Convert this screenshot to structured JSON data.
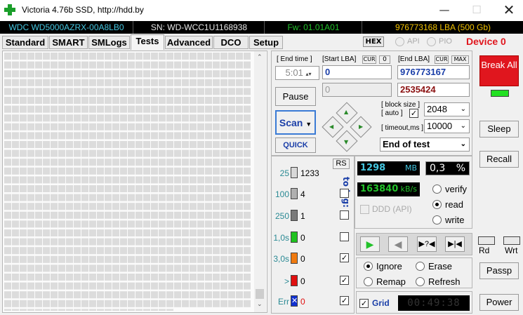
{
  "window": {
    "title": "Victoria 4.76b SSD, http://hdd.by"
  },
  "info": {
    "model": "WDC WD5000AZRX-00A8LB0",
    "serial": "SN: WD-WCC1U1168938",
    "firmware": "Fw: 01.01A01",
    "lba": "976773168 LBA (500 Gb)"
  },
  "tabs": [
    "Standard",
    "SMART",
    "SMLogs",
    "Tests",
    "Advanced",
    "DCO",
    "Setup"
  ],
  "active_tab": "Tests",
  "modes": {
    "hex": "HEX",
    "api": "API",
    "pio": "PIO"
  },
  "device": "Device 0",
  "endtime": {
    "label": "[ End time ]",
    "value": "5:01"
  },
  "startlba": {
    "label": "[Start LBA]",
    "cur": "CUR",
    "zero": "0",
    "value": "0",
    "current": "0"
  },
  "endlba": {
    "label": "[End LBA]",
    "cur": "CUR",
    "max": "MAX",
    "value": "976773167",
    "current": "2535424"
  },
  "buttons": {
    "pause": "Pause",
    "scan": "Scan",
    "quick": "QUICK"
  },
  "blocksize": {
    "label1": "[ block size ]",
    "label2": "[ auto ]",
    "value": "2048"
  },
  "timeout": {
    "label": "[ timeout,ms ]",
    "value": "10000"
  },
  "end_action": "End of test",
  "rs": "RS",
  "to_log": "to log:",
  "levels": [
    {
      "label": "25",
      "count": "1233",
      "color": "#d8d8d8",
      "log": false
    },
    {
      "label": "100",
      "count": "4",
      "color": "#b0b0b0",
      "log": false
    },
    {
      "label": "250",
      "count": "1",
      "color": "#7a7a7a",
      "log": false
    },
    {
      "label": "1,0s",
      "count": "0",
      "color": "#1fc21f",
      "log": false
    },
    {
      "label": "3,0s",
      "count": "0",
      "color": "#f07a10",
      "log": true
    },
    {
      "label": ">",
      "count": "0",
      "color": "#e01010",
      "log": true
    },
    {
      "label": "Err",
      "count": "0",
      "color": "#1030d0",
      "log": true
    }
  ],
  "stats": {
    "mb": "1298",
    "mb_unit": "MB",
    "percent": "0,3",
    "percent_unit": "%",
    "speed": "163840",
    "speed_unit": "kB/s"
  },
  "ddd": "DDD (API)",
  "verify_modes": {
    "verify": "verify",
    "read": "read",
    "write": "write",
    "selected": "read"
  },
  "actions": {
    "ignore": "Ignore",
    "erase": "Erase",
    "remap": "Remap",
    "refresh": "Refresh",
    "selected": "Ignore"
  },
  "grid": {
    "label": "Grid",
    "timer": "00:49:38"
  },
  "right": {
    "break": "Break All",
    "sleep": "Sleep",
    "recall": "Recall",
    "rd": "Rd",
    "wrt": "Wrt",
    "passp": "Passp",
    "power": "Power"
  }
}
